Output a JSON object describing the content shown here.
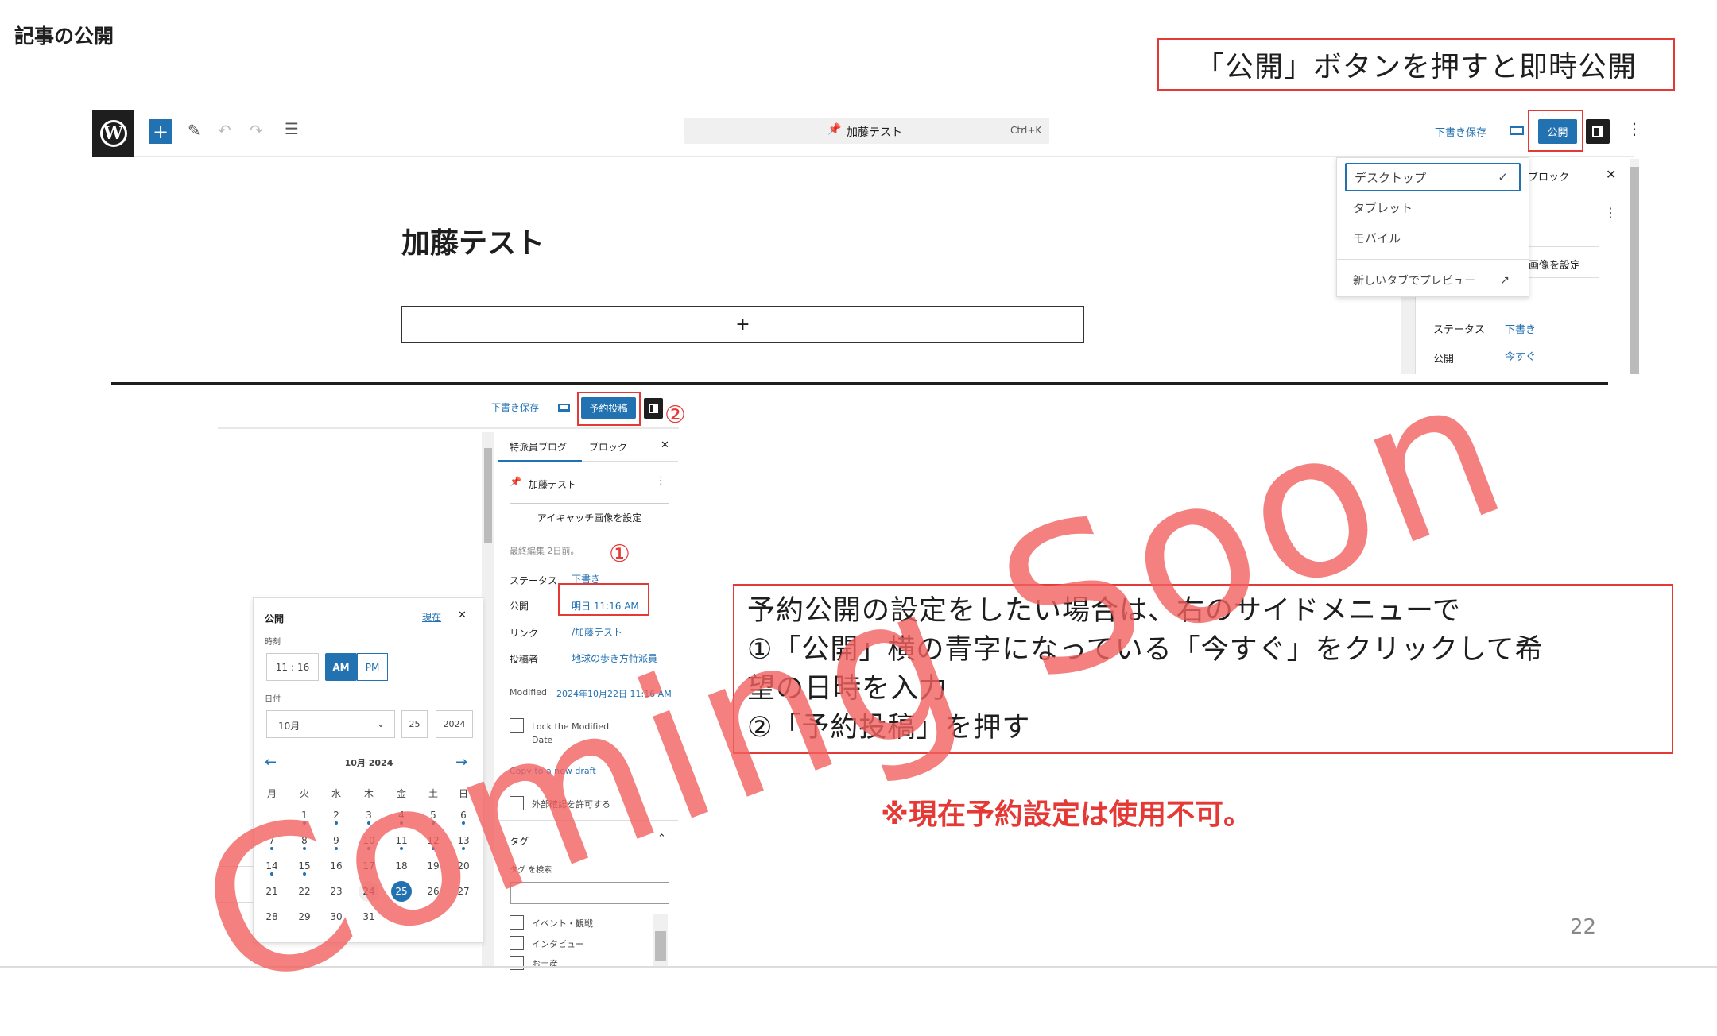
{
  "slide": {
    "title": "記事の公開",
    "callout": "「公開」ボタンを押すと即時公開",
    "page_number": "22",
    "watermark": "Coming Soon",
    "accent": "#2271b1",
    "annotation_red": "#e53935"
  },
  "top": {
    "logo": "W",
    "post_name": "加藤テスト",
    "shortcut": "Ctrl+K",
    "save_draft": "下書き保存",
    "publish": "公開",
    "post_title": "加藤テスト",
    "add_block": "+",
    "preview_menu": {
      "items": [
        "デスクトップ",
        "タブレット",
        "モバイル"
      ],
      "selected": "デスクトップ",
      "check": "✓",
      "new_tab": "新しいタブでプレビュー"
    },
    "sidebar_partial": {
      "tab": "ブロック",
      "featured": "画像を設定",
      "status_label": "ステータス",
      "status_value": "下書き",
      "publish_label": "公開",
      "publish_value": "今すぐ"
    }
  },
  "bottom": {
    "save_draft": "下書き保存",
    "schedule": "予約投稿",
    "marker2": "②",
    "marker1": "①",
    "sidebar": {
      "tabs": [
        "特派員ブログ",
        "ブロック"
      ],
      "post_name": "加藤テスト",
      "featured": "アイキャッチ画像を設定",
      "last_edited": "最終編集 2日前。",
      "status_label": "ステータス",
      "status_value": "下書き",
      "publish_label": "公開",
      "publish_value": "明日 11:16 AM",
      "link_label": "リンク",
      "link_value": "/加藤テスト",
      "author_label": "投稿者",
      "author_value": "地球の歩き方特派員",
      "modified_label": "Modified",
      "modified_value": "2024年10月22日 11:16 AM",
      "lock_label_1": "Lock the Modified",
      "lock_label_2": "Date",
      "copy_draft": "Copy to a new draft",
      "allow_preview": "外部確認を許可する",
      "tags_heading": "タグ",
      "tag_search_label": "タグ を検索",
      "tag_search_value": "",
      "tag_options": [
        "イベント・観戦",
        "インタビュー",
        "お土産"
      ]
    },
    "datepicker": {
      "heading": "公開",
      "now": "現在",
      "time_label": "時刻",
      "hour": "11",
      "minute": "16",
      "am": "AM",
      "pm": "PM",
      "ampm_selected": "AM",
      "date_label": "日付",
      "month": "10月",
      "day": "25",
      "year": "2024",
      "calendar_title": "10月 2024",
      "weekdays": [
        "月",
        "火",
        "水",
        "木",
        "金",
        "土",
        "日"
      ],
      "year_num": 2024,
      "month_num": 10,
      "days_in_month": 31,
      "selected_day": 25,
      "today": 24,
      "days_with_posts": [
        1,
        2,
        3,
        4,
        5,
        6,
        7,
        8,
        9,
        10,
        11,
        12,
        13,
        14,
        15
      ]
    }
  },
  "note": {
    "lines": [
      "予約公開の設定をしたい場合は、右のサイドメニューで",
      "①「公開」横の青字になっている「今すぐ」をクリックして希",
      "望の日時を入力",
      "②「予約投稿」を押す"
    ],
    "warning": "※現在予約設定は使用不可。"
  }
}
